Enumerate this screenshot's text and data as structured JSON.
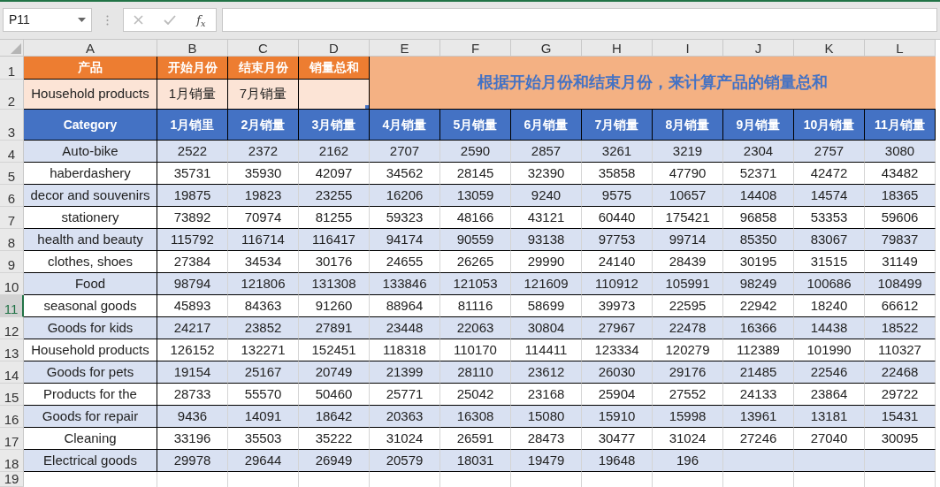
{
  "formula_bar": {
    "name_box": "P11",
    "function_label": "f$_{x}$"
  },
  "column_headers": [
    {
      "label": "A",
      "selected": false
    },
    {
      "label": "B",
      "selected": false
    },
    {
      "label": "C",
      "selected": false
    },
    {
      "label": "D",
      "selected": false
    },
    {
      "label": "E",
      "selected": false
    },
    {
      "label": "F",
      "selected": false
    },
    {
      "label": "G",
      "selected": false
    },
    {
      "label": "H",
      "selected": false
    },
    {
      "label": "I",
      "selected": false
    },
    {
      "label": "J",
      "selected": false
    },
    {
      "label": "K",
      "selected": false
    },
    {
      "label": "L",
      "selected": false
    }
  ],
  "row_headers": [
    {
      "label": "1",
      "selected": false
    },
    {
      "label": "2",
      "selected": false
    },
    {
      "label": "3",
      "selected": false
    },
    {
      "label": "4",
      "selected": false
    },
    {
      "label": "5",
      "selected": false
    },
    {
      "label": "6",
      "selected": false
    },
    {
      "label": "7",
      "selected": false
    },
    {
      "label": "8",
      "selected": false
    },
    {
      "label": "9",
      "selected": false
    },
    {
      "label": "10",
      "selected": false
    },
    {
      "label": "11",
      "selected": true
    },
    {
      "label": "12",
      "selected": false
    },
    {
      "label": "13",
      "selected": false
    },
    {
      "label": "14",
      "selected": false
    },
    {
      "label": "15",
      "selected": false
    },
    {
      "label": "16",
      "selected": false
    },
    {
      "label": "17",
      "selected": false
    },
    {
      "label": "18",
      "selected": false
    },
    {
      "label": "19",
      "selected": false
    }
  ],
  "lookup": {
    "headers": [
      "产品",
      "开始月份",
      "结束月份",
      "销量总和"
    ],
    "values": [
      "Household products",
      "1月销量",
      "7月销量"
    ],
    "note": "根据开始月份和结束月份，来计算产品的销量总和"
  },
  "table": {
    "columns": [
      "Category",
      "1月销里",
      "2月销量",
      "3月销量",
      "4月销量",
      "5月销量",
      "6月销量",
      "7月销量",
      "8月销量",
      "9月销量",
      "10月销量",
      "11月销量"
    ],
    "rows": [
      {
        "category": "Auto-bike",
        "values": [
          "2522",
          "2372",
          "2162",
          "2707",
          "2590",
          "2857",
          "3261",
          "3219",
          "2304",
          "2757",
          "3080"
        ]
      },
      {
        "category": "haberdashery",
        "values": [
          "35731",
          "35930",
          "42097",
          "34562",
          "28145",
          "32390",
          "35858",
          "47790",
          "52371",
          "42472",
          "43482"
        ]
      },
      {
        "category": "decor and souvenirs",
        "values": [
          "19875",
          "19823",
          "23255",
          "16206",
          "13059",
          "9240",
          "9575",
          "10657",
          "14408",
          "14574",
          "18365"
        ]
      },
      {
        "category": "stationery",
        "values": [
          "73892",
          "70974",
          "81255",
          "59323",
          "48166",
          "43121",
          "60440",
          "175421",
          "96858",
          "53353",
          "59606"
        ]
      },
      {
        "category": "health and beauty",
        "values": [
          "115792",
          "116714",
          "116417",
          "94174",
          "90559",
          "93138",
          "97753",
          "99714",
          "85350",
          "83067",
          "79837"
        ]
      },
      {
        "category": "clothes, shoes",
        "values": [
          "27384",
          "34534",
          "30176",
          "24655",
          "26265",
          "29990",
          "24140",
          "28439",
          "30195",
          "31515",
          "31149"
        ]
      },
      {
        "category": "Food",
        "values": [
          "98794",
          "121806",
          "131308",
          "133846",
          "121053",
          "121609",
          "110912",
          "105991",
          "98249",
          "100686",
          "108499"
        ]
      },
      {
        "category": "seasonal goods",
        "values": [
          "45893",
          "84363",
          "91260",
          "88964",
          "81116",
          "58699",
          "39973",
          "22595",
          "22942",
          "18240",
          "66612"
        ]
      },
      {
        "category": "Goods for kids",
        "values": [
          "24217",
          "23852",
          "27891",
          "23448",
          "22063",
          "30804",
          "27967",
          "22478",
          "16366",
          "14438",
          "18522"
        ]
      },
      {
        "category": "Household products",
        "values": [
          "126152",
          "132271",
          "152451",
          "118318",
          "110170",
          "114411",
          "123334",
          "120279",
          "112389",
          "101990",
          "110327"
        ]
      },
      {
        "category": "Goods for pets",
        "values": [
          "19154",
          "25167",
          "20749",
          "21399",
          "28110",
          "23612",
          "26030",
          "29176",
          "21485",
          "22546",
          "22468"
        ]
      },
      {
        "category": "Products for the",
        "values": [
          "28733",
          "55570",
          "50460",
          "25771",
          "25042",
          "23168",
          "25904",
          "27552",
          "24133",
          "23864",
          "29722"
        ]
      },
      {
        "category": "Goods for repair",
        "values": [
          "9436",
          "14091",
          "18642",
          "20363",
          "16308",
          "15080",
          "15910",
          "15998",
          "13961",
          "13181",
          "15431"
        ]
      },
      {
        "category": "Cleaning",
        "values": [
          "33196",
          "35503",
          "35222",
          "31024",
          "26591",
          "28473",
          "30477",
          "31024",
          "27246",
          "27040",
          "30095"
        ]
      },
      {
        "category": "Electrical goods",
        "values": [
          "29978",
          "29644",
          "26949",
          "20579",
          "18031",
          "19479",
          "19648",
          "196"
        ]
      }
    ]
  }
}
